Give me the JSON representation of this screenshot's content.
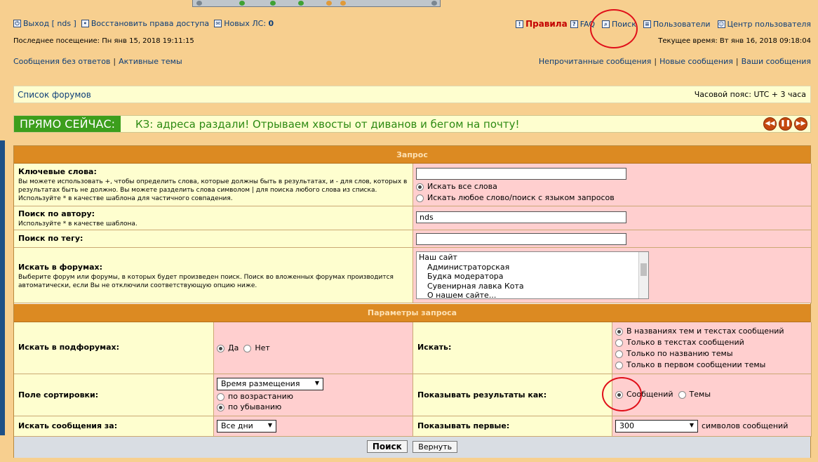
{
  "nav": {
    "logout": "Выход [ nds ]",
    "restore": "Восстановить права доступа",
    "pm_label": "Новых ЛС:",
    "pm_count": "0",
    "rules": "Правила",
    "faq": "FAQ",
    "search": "Поиск",
    "users": "Пользователи",
    "ucp": "Центр пользователя",
    "last_visit": "Последнее посещение: Пн янв 15, 2018 19:11:15",
    "current_time": "Текущее время: Вт янв 16, 2018 09:18:04",
    "unanswered": "Сообщения без ответов",
    "active": "Активные темы",
    "unread": "Непрочитанные сообщения",
    "new_posts": "Новые сообщения",
    "your_posts": "Ваши сообщения"
  },
  "breadcrumb": {
    "forum_list": "Список форумов",
    "timezone": "Часовой пояс: UTC + 3 часа"
  },
  "news": {
    "tag": "ПРЯМО СЕЙЧАС:",
    "text": "КЗ: адреса раздали! Отрываем хвосты от диванов и бегом на почту!"
  },
  "query": {
    "header": "Запрос",
    "keywords": {
      "label": "Ключевые слова:",
      "desc": "Вы можете использовать +, чтобы определить слова, которые должны быть в результатах, и - для слов, которых в результатах быть не должно. Вы можете разделить слова символом | для поиска любого слова из списка. Используйте * в качестве шаблона для частичного совпадения.",
      "value": "",
      "opt_all": "Искать все слова",
      "opt_any": "Искать любое слово/поиск с языком запросов"
    },
    "author": {
      "label": "Поиск по автору:",
      "desc": "Используйте * в качестве шаблона.",
      "value": "nds"
    },
    "tag": {
      "label": "Поиск по тегу:",
      "value": ""
    },
    "forums": {
      "label": "Искать в форумах:",
      "desc": "Выберите форум или форумы, в которых будет произведен поиск. Поиск во вложенных форумах производится автоматически, если Вы не отключили соответствующую опцию ниже.",
      "items": [
        "Наш сайт",
        "Администраторская",
        "Будка модератора",
        "Сувенирная лавка Кота",
        "О нашем сайте..."
      ]
    }
  },
  "params": {
    "header": "Параметры запроса",
    "subforums": {
      "label": "Искать в подфорумах:",
      "yes": "Да",
      "no": "Нет"
    },
    "search_in": {
      "label": "Искать:",
      "opts": [
        "В названиях тем и текстах сообщений",
        "Только в текстах сообщений",
        "Только по названию темы",
        "Только в первом сообщении темы"
      ]
    },
    "sort": {
      "label": "Поле сортировки:",
      "field": "Время размещения",
      "asc": "по возрастанию",
      "desc": "по убыванию"
    },
    "show_as": {
      "label": "Показывать результаты как:",
      "posts": "Сообщений",
      "topics": "Темы"
    },
    "period": {
      "label": "Искать сообщения за:",
      "value": "Все дни"
    },
    "show_first": {
      "label": "Показывать первые:",
      "value": "300",
      "suffix": "символов сообщений"
    }
  },
  "buttons": {
    "search": "Поиск",
    "reset": "Вернуть"
  },
  "colors": {
    "background": "#f7cf8f",
    "header": "#dc8a22",
    "cell_yellow": "#fefecf",
    "cell_pink": "#ffcfcf",
    "news_green": "#3c9e1c",
    "annotation_red": "#e0101a"
  }
}
